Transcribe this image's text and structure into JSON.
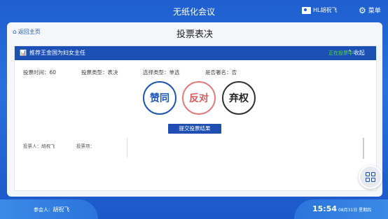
{
  "header": {
    "app_title": "无纸化会议",
    "user_name": "HL胡祝飞",
    "menu_label": "菜单"
  },
  "panel": {
    "back_label": "返回主页",
    "page_title": "投票表决"
  },
  "vote": {
    "title": "推荐王金国为妇女主任",
    "status": "正在投票中",
    "collapse_label": "收起",
    "info": {
      "time_label": "投票时间：",
      "time_value": "60",
      "type_label": "投票类型：",
      "type_value": "表决",
      "select_label": "选择类型：",
      "select_value": "单选",
      "anon_label": "是否署名：",
      "anon_value": "否"
    },
    "options": [
      "赞同",
      "反对",
      "弃权"
    ],
    "submit_label": "提交投票结果",
    "voter_label": "投票人：",
    "voter_value": "胡祝飞",
    "item_label": "投票项："
  },
  "footer": {
    "participant_label": "参会人:",
    "participant_name": "胡祝飞",
    "time": "15:54",
    "date": "08月31日 星期四"
  },
  "colors": {
    "primary": "#1d50b5",
    "approve": "#1f55b8",
    "oppose": "#e05a5a",
    "abstain": "#222222",
    "status": "#5bd35b"
  }
}
